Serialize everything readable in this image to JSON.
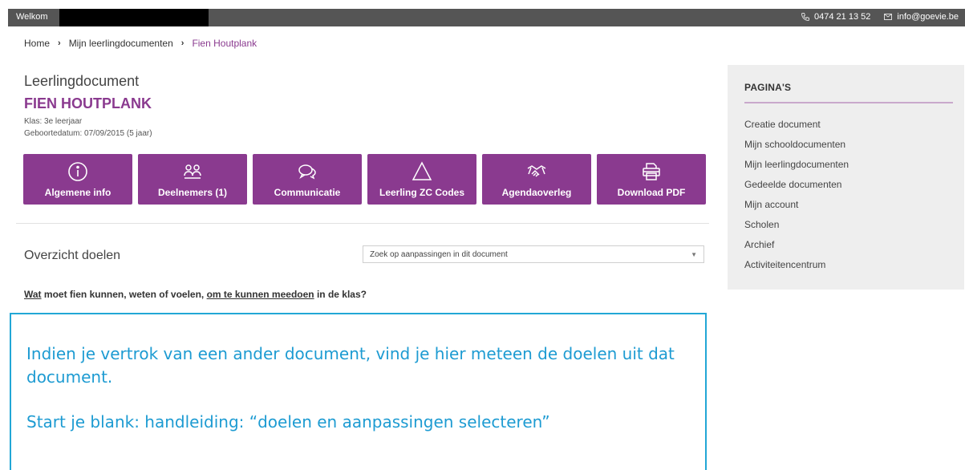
{
  "topbar": {
    "welcome": "Welkom",
    "phone": "0474 21 13 52",
    "email": "info@goevie.be"
  },
  "breadcrumb": {
    "home": "Home",
    "parent": "Mijn leerlingdocumenten",
    "current": "Fien Houtplank"
  },
  "document": {
    "label": "Leerlingdocument",
    "student_name": "FIEN HOUTPLANK",
    "klas": "Klas: 3e leerjaar",
    "geboortedatum": "Geboortedatum: 07/09/2015 (5 jaar)"
  },
  "buttons": [
    {
      "label": "Algemene info",
      "icon": "info-icon"
    },
    {
      "label": "Deelnemers (1)",
      "icon": "users-icon"
    },
    {
      "label": "Communicatie",
      "icon": "chat-icon"
    },
    {
      "label": "Leerling ZC Codes",
      "icon": "triangle-icon"
    },
    {
      "label": "Agendaoverleg",
      "icon": "handshake-icon"
    },
    {
      "label": "Download PDF",
      "icon": "printer-icon"
    }
  ],
  "overview": {
    "title": "Overzicht doelen",
    "search_placeholder": "Zoek op aanpassingen in dit document"
  },
  "question": {
    "part1": "Wat",
    "part2": " moet fien kunnen, weten of voelen, ",
    "part3": "om te kunnen meedoen",
    "part4": " in de klas?"
  },
  "sidebar": {
    "title": "PAGINA'S",
    "items": [
      "Creatie document",
      "Mijn schooldocumenten",
      "Mijn leerlingdocumenten",
      "Gedeelde documenten",
      "Mijn account",
      "Scholen",
      "Archief",
      "Activiteitencentrum"
    ]
  },
  "callout": {
    "line1": "Indien je vertrok van een ander document, vind je hier meteen de doelen uit dat document.",
    "line2": "Start je blank: handleiding: “doelen en aanpassingen selecteren”"
  },
  "colors": {
    "brand": "#8a3a8f",
    "topbar": "#555555",
    "callout": "#22a7d6"
  }
}
